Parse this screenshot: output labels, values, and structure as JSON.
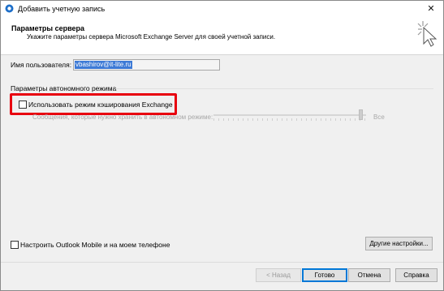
{
  "window": {
    "title": "Добавить учетную запись",
    "close_glyph": "✕"
  },
  "header": {
    "title": "Параметры сервера",
    "subtitle": "Укажите параметры сервера Microsoft Exchange Server для своей учетной записи."
  },
  "form": {
    "username_label": "Имя пользователя:",
    "username_value": "vbashirov@it-lite.ru",
    "offline_section_label": "Параметры автономного режима",
    "cached_mode_label": "Использовать режим кэширования Exchange",
    "cached_mode_checked": false,
    "mail_to_keep_label": "Сообщения, которые нужно хранить в автономном режиме:",
    "slider_value_label": "Все",
    "mobile_label": "Настроить Outlook Mobile и на моем телефоне",
    "mobile_checked": false
  },
  "buttons": {
    "more_settings": "Другие настройки...",
    "back": "< Назад",
    "done": "Готово",
    "cancel": "Отмена",
    "help": "Справка"
  },
  "colors": {
    "highlight": "#e8000f",
    "selection": "#3d7ad6",
    "primary_border": "#0078d7"
  },
  "icons": {
    "app": "outlook-icon",
    "close": "close-icon",
    "cursor": "pointer-click-icon"
  }
}
